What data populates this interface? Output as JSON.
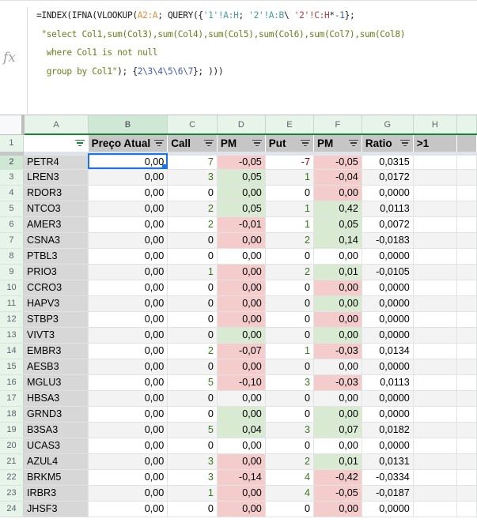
{
  "formula_bar": {
    "fx_label": "fx",
    "lines": [
      {
        "parts": [
          {
            "t": "=INDEX(IFNA(VLOOKUP(",
            "c": ""
          },
          {
            "t": "A2:A",
            "c": "f-ref-a"
          },
          {
            "t": "; QUERY({",
            "c": ""
          },
          {
            "t": "'1'!A:H",
            "c": "f-ref-t"
          },
          {
            "t": "; ",
            "c": ""
          },
          {
            "t": "'2'!A:B",
            "c": "f-ref-t"
          },
          {
            "t": "\\ ",
            "c": ""
          },
          {
            "t": "'2'!C:H",
            "c": "f-red"
          },
          {
            "t": "*",
            "c": ""
          },
          {
            "t": "-1",
            "c": "f-num"
          },
          {
            "t": "};",
            "c": ""
          }
        ]
      },
      {
        "parts": [
          {
            "t": " \"select Col1,sum(Col3),sum(Col4),sum(Col5),sum(Col6),sum(Col7),sum(Col8)",
            "c": "f-str"
          }
        ]
      },
      {
        "parts": [
          {
            "t": "  where Col1 is not null",
            "c": "f-str"
          }
        ]
      },
      {
        "parts": [
          {
            "t": "  group by Col1\"",
            "c": "f-str"
          },
          {
            "t": "); {",
            "c": ""
          },
          {
            "t": "2\\3\\4\\5\\6\\7",
            "c": "f-num"
          },
          {
            "t": "}; )))",
            "c": ""
          }
        ]
      }
    ]
  },
  "columns": [
    "A",
    "B",
    "C",
    "D",
    "E",
    "F",
    "G",
    "H"
  ],
  "selected_column": "B",
  "selected_row": 2,
  "header_row": [
    "",
    "Preço Atual",
    "Call",
    "PM",
    "Put",
    "PM",
    "Ratio",
    ">1"
  ],
  "colors": {
    "fill_red": "#f4cccc",
    "fill_green": "#d9ead3",
    "text_positive": "#38761d",
    "text_negative": "#990000",
    "selection": "#1a73e8"
  },
  "rows": [
    {
      "n": 2,
      "ticker": "PETR4",
      "preco": "0,00",
      "call": "7",
      "pm_call": "-0,05",
      "pm_call_fill": "red",
      "put": "-7",
      "pm_put": "-0,05",
      "pm_put_fill": "red",
      "ratio": "0,0315"
    },
    {
      "n": 3,
      "ticker": "LREN3",
      "preco": "0,00",
      "call": "3",
      "pm_call": "0,05",
      "pm_call_fill": "green",
      "put": "1",
      "pm_put": "-0,04",
      "pm_put_fill": "red",
      "ratio": "0,0172"
    },
    {
      "n": 4,
      "ticker": "RDOR3",
      "preco": "0,00",
      "call": "0",
      "pm_call": "0,00",
      "pm_call_fill": "green",
      "put": "0",
      "pm_put": "0,00",
      "pm_put_fill": "red",
      "ratio": "0,0000"
    },
    {
      "n": 5,
      "ticker": "NTCO3",
      "preco": "0,00",
      "call": "2",
      "pm_call": "0,05",
      "pm_call_fill": "green",
      "put": "1",
      "pm_put": "0,42",
      "pm_put_fill": "green",
      "ratio": "0,0113"
    },
    {
      "n": 6,
      "ticker": "AMER3",
      "preco": "0,00",
      "call": "2",
      "pm_call": "-0,01",
      "pm_call_fill": "red",
      "put": "1",
      "pm_put": "0,05",
      "pm_put_fill": "green",
      "ratio": "0,0072"
    },
    {
      "n": 7,
      "ticker": "CSNA3",
      "preco": "0,00",
      "call": "0",
      "pm_call": "0,00",
      "pm_call_fill": "red",
      "put": "2",
      "pm_put": "0,14",
      "pm_put_fill": "green",
      "ratio": "-0,0183"
    },
    {
      "n": 8,
      "ticker": "PTBL3",
      "preco": "0,00",
      "call": "0",
      "pm_call": "0,00",
      "pm_call_fill": "",
      "put": "0",
      "pm_put": "0,00",
      "pm_put_fill": "",
      "ratio": "0,0000"
    },
    {
      "n": 9,
      "ticker": "PRIO3",
      "preco": "0,00",
      "call": "1",
      "pm_call": "0,00",
      "pm_call_fill": "red",
      "put": "2",
      "pm_put": "0,01",
      "pm_put_fill": "green",
      "ratio": "-0,0105"
    },
    {
      "n": 10,
      "ticker": "CCRO3",
      "preco": "0,00",
      "call": "0",
      "pm_call": "0,00",
      "pm_call_fill": "red",
      "put": "0",
      "pm_put": "0,00",
      "pm_put_fill": "red",
      "ratio": "0,0000"
    },
    {
      "n": 11,
      "ticker": "HAPV3",
      "preco": "0,00",
      "call": "0",
      "pm_call": "0,00",
      "pm_call_fill": "red",
      "put": "0",
      "pm_put": "0,00",
      "pm_put_fill": "green",
      "ratio": "0,0000"
    },
    {
      "n": 12,
      "ticker": "STBP3",
      "preco": "0,00",
      "call": "0",
      "pm_call": "0,00",
      "pm_call_fill": "red",
      "put": "0",
      "pm_put": "0,00",
      "pm_put_fill": "red",
      "ratio": "0,0000"
    },
    {
      "n": 13,
      "ticker": "VIVT3",
      "preco": "0,00",
      "call": "0",
      "pm_call": "0,00",
      "pm_call_fill": "green",
      "put": "0",
      "pm_put": "0,00",
      "pm_put_fill": "green",
      "ratio": "0,0000"
    },
    {
      "n": 14,
      "ticker": "EMBR3",
      "preco": "0,00",
      "call": "2",
      "pm_call": "-0,07",
      "pm_call_fill": "red",
      "put": "1",
      "pm_put": "-0,03",
      "pm_put_fill": "red",
      "ratio": "0,0134"
    },
    {
      "n": 15,
      "ticker": "AESB3",
      "preco": "0,00",
      "call": "0",
      "pm_call": "0,00",
      "pm_call_fill": "red",
      "put": "0",
      "pm_put": "0,00",
      "pm_put_fill": "",
      "ratio": "0,0000"
    },
    {
      "n": 16,
      "ticker": "MGLU3",
      "preco": "0,00",
      "call": "5",
      "pm_call": "-0,10",
      "pm_call_fill": "red",
      "put": "3",
      "pm_put": "-0,03",
      "pm_put_fill": "red",
      "ratio": "0,0113"
    },
    {
      "n": 17,
      "ticker": "HBSA3",
      "preco": "0,00",
      "call": "0",
      "pm_call": "0,00",
      "pm_call_fill": "",
      "put": "0",
      "pm_put": "0,00",
      "pm_put_fill": "",
      "ratio": "0,0000"
    },
    {
      "n": 18,
      "ticker": "GRND3",
      "preco": "0,00",
      "call": "0",
      "pm_call": "0,00",
      "pm_call_fill": "green",
      "put": "0",
      "pm_put": "0,00",
      "pm_put_fill": "green",
      "ratio": "0,0000"
    },
    {
      "n": 19,
      "ticker": "B3SA3",
      "preco": "0,00",
      "call": "5",
      "pm_call": "0,04",
      "pm_call_fill": "green",
      "put": "3",
      "pm_put": "0,07",
      "pm_put_fill": "green",
      "ratio": "0,0182"
    },
    {
      "n": 20,
      "ticker": "UCAS3",
      "preco": "0,00",
      "call": "0",
      "pm_call": "0,00",
      "pm_call_fill": "",
      "put": "0",
      "pm_put": "0,00",
      "pm_put_fill": "",
      "ratio": "0,0000"
    },
    {
      "n": 21,
      "ticker": "AZUL4",
      "preco": "0,00",
      "call": "3",
      "pm_call": "0,00",
      "pm_call_fill": "red",
      "put": "2",
      "pm_put": "0,01",
      "pm_put_fill": "green",
      "ratio": "0,0131"
    },
    {
      "n": 22,
      "ticker": "BRKM5",
      "preco": "0,00",
      "call": "3",
      "pm_call": "-0,14",
      "pm_call_fill": "red",
      "put": "4",
      "pm_put": "-0,42",
      "pm_put_fill": "red",
      "ratio": "-0,0334"
    },
    {
      "n": 23,
      "ticker": "IRBR3",
      "preco": "0,00",
      "call": "1",
      "pm_call": "0,00",
      "pm_call_fill": "red",
      "put": "4",
      "pm_put": "-0,05",
      "pm_put_fill": "red",
      "ratio": "-0,0187"
    },
    {
      "n": 24,
      "ticker": "JHSF3",
      "preco": "0,00",
      "call": "0",
      "pm_call": "0,00",
      "pm_call_fill": "red",
      "put": "0",
      "pm_put": "0,00",
      "pm_put_fill": "red",
      "ratio": "0,0000"
    }
  ]
}
